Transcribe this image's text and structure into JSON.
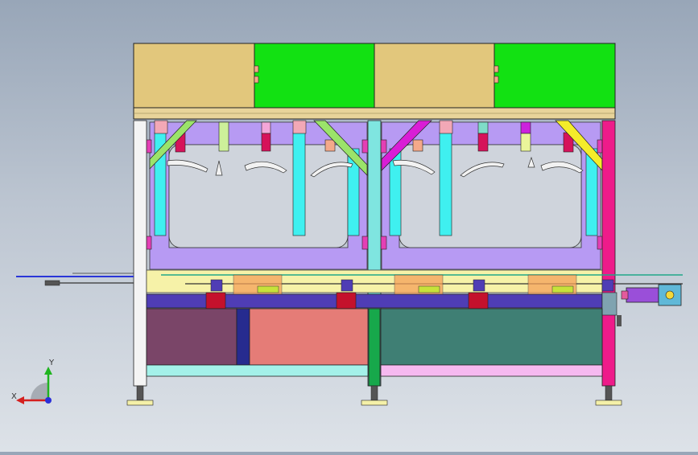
{
  "colors": {
    "cabinet_tan": "#e2c77c",
    "cabinet_green": "#12e112",
    "frame_purple": "#b79af3",
    "post_white": "#f4f4f4",
    "post_cyan": "#7fe5e0",
    "post_green": "#17a84b",
    "post_magenta": "#ee1b8a",
    "rail_blue": "#4f3db5",
    "brace_green": "#9be36a",
    "brace_magenta": "#d91dd6",
    "brace_yellow": "#f4ec2a",
    "panel_plum": "#7a4568",
    "panel_salmon": "#e57c77",
    "panel_teal": "#3f7f74",
    "base_cyan": "#a4f1e9",
    "base_pink": "#f6b9f0",
    "motor_purple": "#9a4fd9",
    "bracket_red": "#c4112c",
    "pad_pink": "#f2a8b6"
  },
  "icons": {
    "view_triad": "axis-triad-icon"
  },
  "triad": {
    "x_label": "X",
    "y_label": "Y"
  }
}
